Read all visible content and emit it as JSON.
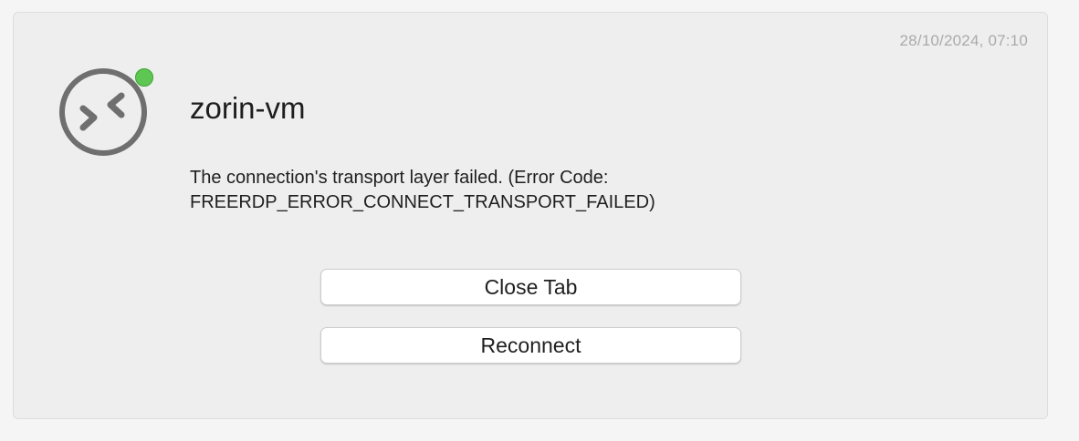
{
  "session": {
    "timestamp": "28/10/2024, 07:10",
    "host_name": "zorin-vm",
    "status": "online",
    "status_color": "#5ec653",
    "icon": "remote-desktop-icon"
  },
  "error": {
    "line1": "The connection's transport layer failed. (Error Code:",
    "line2": "FREERDP_ERROR_CONNECT_TRANSPORT_FAILED)"
  },
  "actions": {
    "close_tab_label": "Close Tab",
    "reconnect_label": "Reconnect"
  }
}
